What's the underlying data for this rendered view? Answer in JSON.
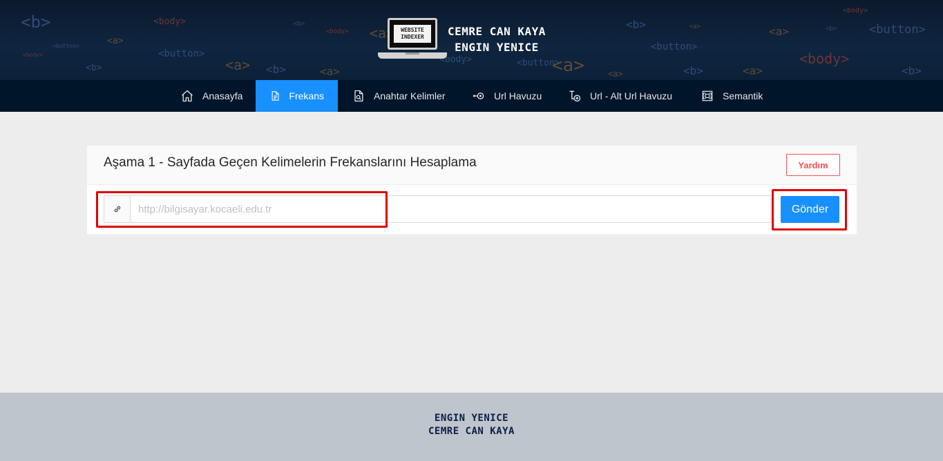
{
  "banner": {
    "logo_text_line1": "WEBSITE",
    "logo_text_line2": "INDEXER",
    "name_line1": "CEMRE CAN KAYA",
    "name_line2": "ENGIN YENICE",
    "bg_tags": [
      "<b>",
      "<body>",
      "<a>",
      "<button>",
      "<b>",
      "<body>",
      "<a>",
      "<button>",
      "<b>",
      "<body>",
      "<a>",
      "<b>",
      "<a>",
      "<button>",
      "<body>",
      "<b>",
      "<a>",
      "<button>",
      "<b>",
      "<a>",
      "<body>",
      "<a>",
      "<b>",
      "<button>",
      "<a>",
      "<b>",
      "<body>",
      "<a>"
    ]
  },
  "nav": {
    "items": [
      {
        "label": "Anasayfa",
        "icon": "home-icon"
      },
      {
        "label": "Frekans",
        "icon": "file-text-icon",
        "active": true
      },
      {
        "label": "Anahtar Kelimler",
        "icon": "file-search-icon"
      },
      {
        "label": "Url Havuzu",
        "icon": "node-icon"
      },
      {
        "label": "Url - Alt Url Havuzu",
        "icon": "branch-icon"
      },
      {
        "label": "Semantik",
        "icon": "command-icon"
      }
    ]
  },
  "card": {
    "title": "Aşama 1 - Sayfada Geçen Kelimelerin Frekanslarını Hesaplama",
    "help_label": "Yardım",
    "url_placeholder": "http://bilgisayar.kocaeli.edu.tr",
    "url_value": "",
    "submit_label": "Gönder"
  },
  "footer": {
    "line1": "ENGIN YENICE",
    "line2": "CEMRE CAN KAYA"
  },
  "colors": {
    "accent": "#1890ff",
    "danger": "#ff4d4f",
    "nav_bg": "#001529",
    "highlight": "#e00000",
    "footer_bg": "#bec5cc"
  }
}
